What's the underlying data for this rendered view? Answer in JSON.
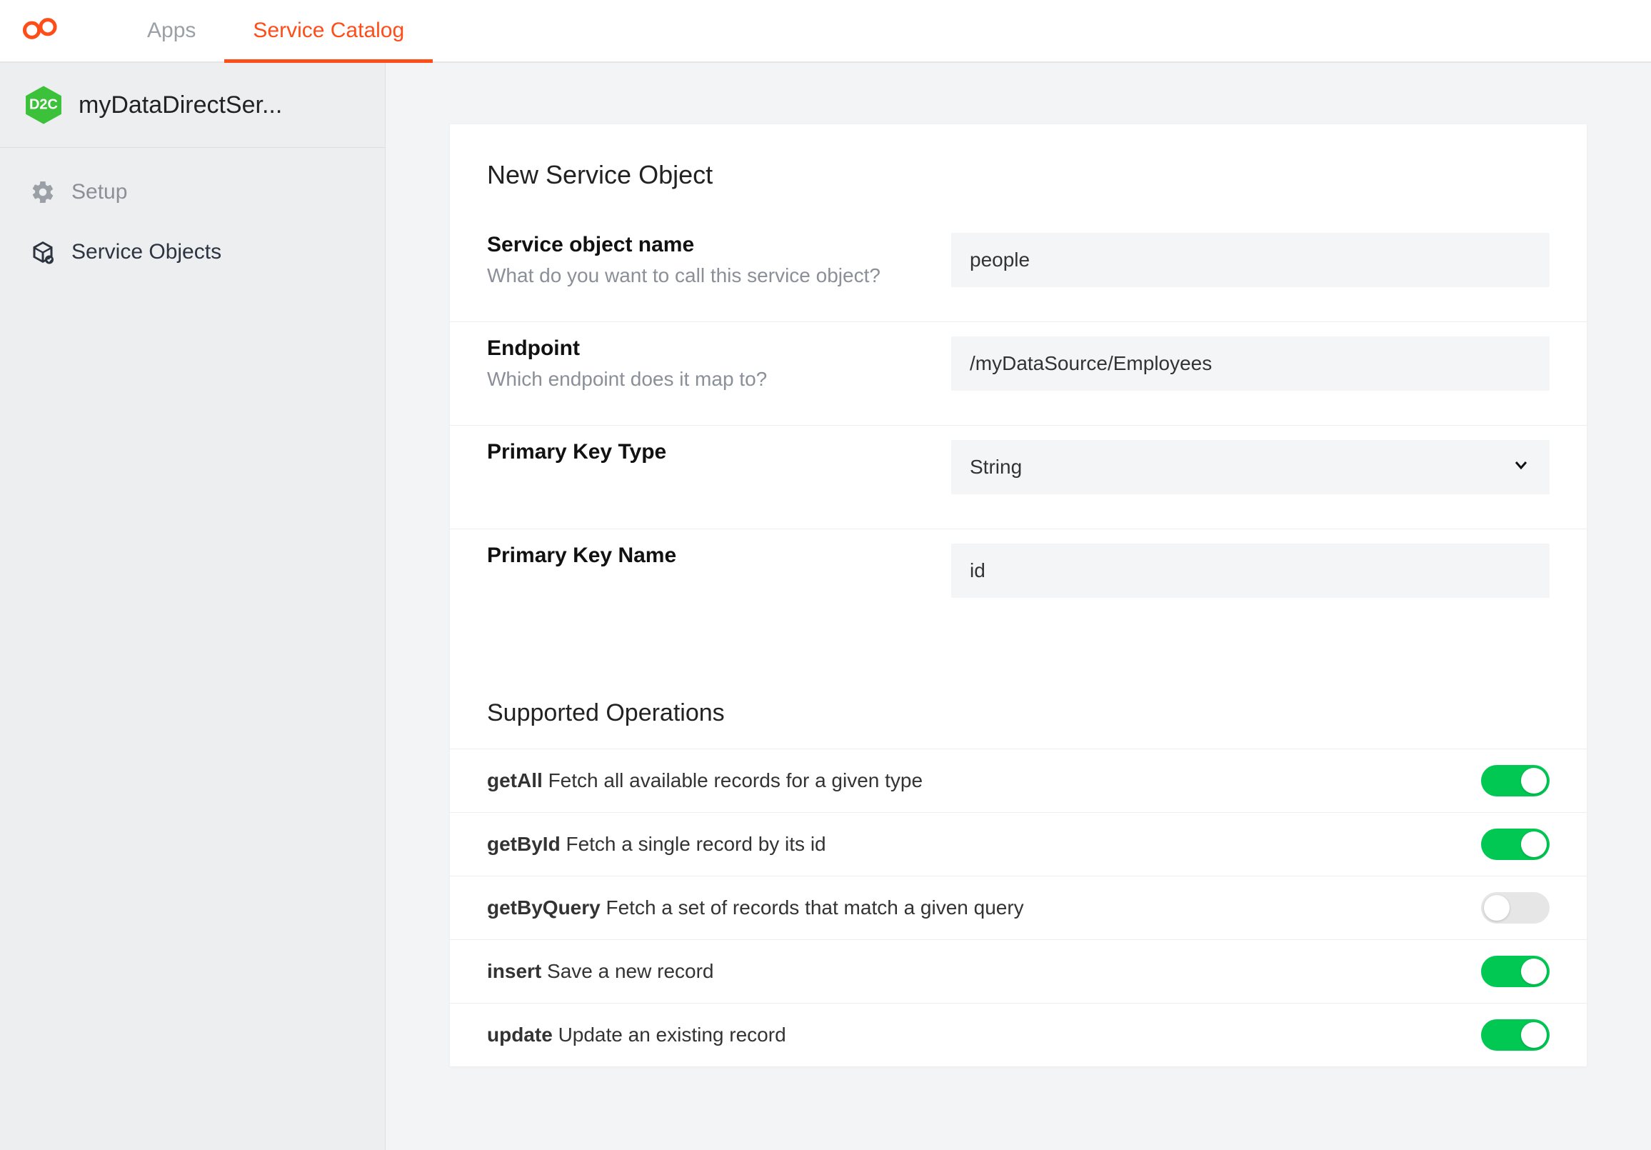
{
  "nav": {
    "tabs": [
      {
        "label": "Apps",
        "active": false
      },
      {
        "label": "Service Catalog",
        "active": true
      }
    ]
  },
  "sidebar": {
    "badge": "D2C",
    "title": "myDataDirectSer...",
    "items": [
      {
        "label": "Setup",
        "active": false,
        "icon": "gear-icon"
      },
      {
        "label": "Service Objects",
        "active": true,
        "icon": "cube-icon"
      }
    ]
  },
  "form": {
    "title": "New Service Object",
    "fields": {
      "name": {
        "label": "Service object name",
        "help": "What do you want to call this service object?",
        "value": "people"
      },
      "endpoint": {
        "label": "Endpoint",
        "help": "Which endpoint does it map to?",
        "value": "/myDataSource/Employees"
      },
      "pkType": {
        "label": "Primary Key Type",
        "value": "String"
      },
      "pkName": {
        "label": "Primary Key Name",
        "value": "id"
      }
    },
    "operationsTitle": "Supported Operations",
    "operations": [
      {
        "name": "getAll",
        "desc": "Fetch all available records for a given type",
        "on": true
      },
      {
        "name": "getById",
        "desc": "Fetch a single record by its id",
        "on": true
      },
      {
        "name": "getByQuery",
        "desc": "Fetch a set of records that match a given query",
        "on": false
      },
      {
        "name": "insert",
        "desc": "Save a new record",
        "on": true
      },
      {
        "name": "update",
        "desc": "Update an existing record",
        "on": true
      }
    ]
  }
}
